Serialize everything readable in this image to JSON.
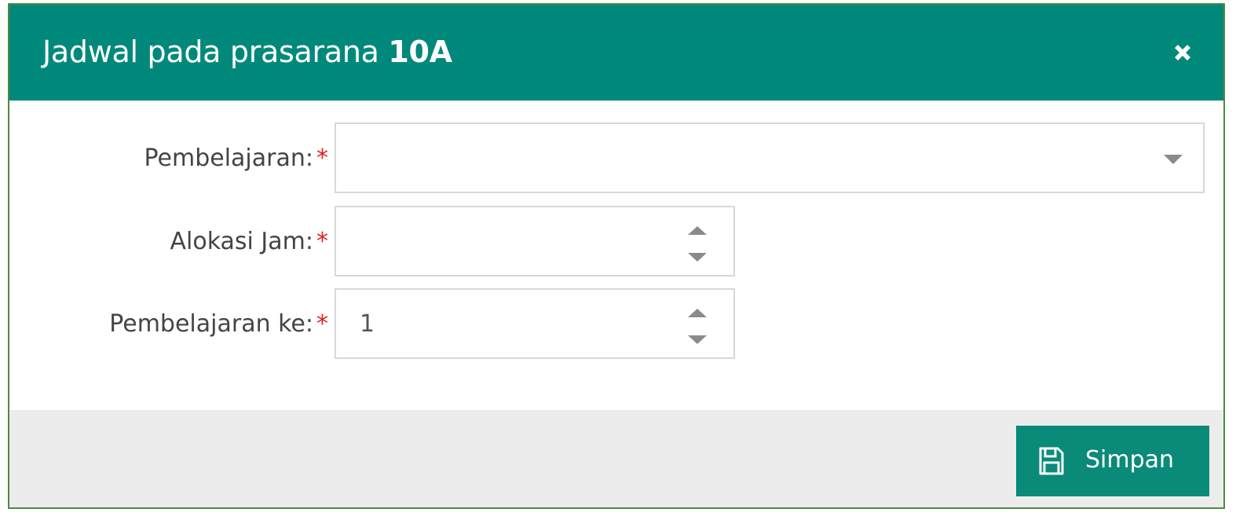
{
  "dialog": {
    "title_prefix": "Jadwal pada prasarana",
    "title_name": "10A"
  },
  "form": {
    "required_marker": "*",
    "fields": [
      {
        "label": "Pembelajaran:",
        "value": ""
      },
      {
        "label": "Alokasi Jam:",
        "value": ""
      },
      {
        "label": "Pembelajaran ke:",
        "value": "1"
      }
    ]
  },
  "footer": {
    "save_label": "Simpan"
  },
  "icons": {
    "close": "close-icon",
    "dropdown": "chevron-down-icon",
    "spin_up": "spin-up-icon",
    "spin_down": "spin-down-icon",
    "save": "floppy-disk-icon"
  },
  "colors": {
    "header_bg": "#00897b",
    "button_bg": "#0a8a78",
    "required": "#e02020",
    "footer_bg": "#ececec"
  }
}
